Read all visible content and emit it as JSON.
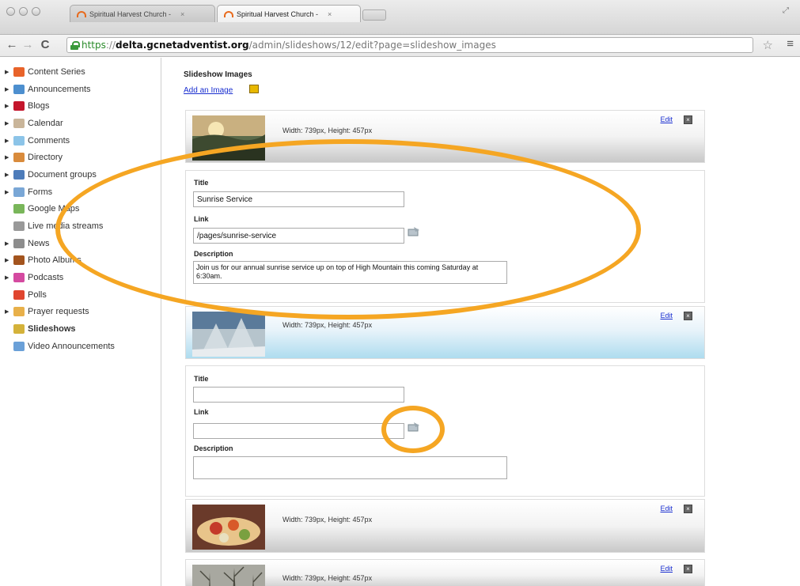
{
  "browser": {
    "tabs": [
      {
        "label": "Spiritual Harvest Church - ",
        "close": "×"
      },
      {
        "label": "Spiritual Harvest Church - ",
        "close": "×"
      }
    ],
    "url": {
      "scheme": "https",
      "separator": "://",
      "host": "delta.gcnetadventist.org",
      "path": "/admin/slideshows/12/edit?page=slideshow_images"
    },
    "icons": {
      "back": "back-arrow-icon",
      "forward": "forward-arrow-icon",
      "reload": "reload-icon",
      "lock": "lock-icon",
      "bookmark": "star-icon",
      "menu": "hamburger-menu-icon"
    }
  },
  "sidebar": {
    "items": [
      {
        "label": "Content Series",
        "expandable": true,
        "icon": "content-series-icon",
        "color": "#e8632a"
      },
      {
        "label": "Announcements",
        "expandable": true,
        "icon": "megaphone-icon",
        "color": "#4d8fcf"
      },
      {
        "label": "Blogs",
        "expandable": true,
        "icon": "book-icon",
        "color": "#c4162c"
      },
      {
        "label": "Calendar",
        "expandable": true,
        "icon": "calendar-icon",
        "color": "#c9b59a"
      },
      {
        "label": "Comments",
        "expandable": true,
        "icon": "speech-bubble-icon",
        "color": "#8cc4e8"
      },
      {
        "label": "Directory",
        "expandable": true,
        "icon": "person-icon",
        "color": "#d98b3c"
      },
      {
        "label": "Document groups",
        "expandable": true,
        "icon": "documents-icon",
        "color": "#4d7cba"
      },
      {
        "label": "Forms",
        "expandable": true,
        "icon": "form-icon",
        "color": "#7aa7d6"
      },
      {
        "label": "Google Maps",
        "expandable": false,
        "icon": "map-icon",
        "color": "#79b65a"
      },
      {
        "label": "Live media streams",
        "expandable": false,
        "icon": "antenna-icon",
        "color": "#999999"
      },
      {
        "label": "News",
        "expandable": true,
        "icon": "newspaper-icon",
        "color": "#8d8d8d"
      },
      {
        "label": "Photo Albums",
        "expandable": true,
        "icon": "photo-album-icon",
        "color": "#a3541e"
      },
      {
        "label": "Podcasts",
        "expandable": true,
        "icon": "microphone-icon",
        "color": "#d44aa0"
      },
      {
        "label": "Polls",
        "expandable": false,
        "icon": "bar-chart-icon",
        "color": "#e0452f"
      },
      {
        "label": "Prayer requests",
        "expandable": true,
        "icon": "pencil-icon",
        "color": "#e8b04a"
      },
      {
        "label": "Slideshows",
        "expandable": false,
        "icon": "slideshow-icon",
        "color": "#d4b23a",
        "active": true
      },
      {
        "label": "Video Announcements",
        "expandable": false,
        "icon": "video-icon",
        "color": "#6aa0d8"
      }
    ]
  },
  "main": {
    "section_title": "Slideshow Images",
    "add_image_label": "Add an Image",
    "edit_label": "Edit",
    "images": [
      {
        "dimensions": "Width: 739px, Height: 457px",
        "thumb": "sunrise-landscape"
      },
      {
        "dimensions": "Width: 739px, Height: 457px",
        "thumb": "snowy-trees"
      },
      {
        "dimensions": "Width: 739px, Height: 457px",
        "thumb": "food-dish"
      },
      {
        "dimensions": "Width: 739px, Height: 457px",
        "thumb": "bare-trees"
      }
    ],
    "forms": [
      {
        "title_label": "Title",
        "title_value": "Sunrise Service",
        "link_label": "Link",
        "link_value": "/pages/sunrise-service",
        "description_label": "Description",
        "description_value": "Join us for our annual sunrise service up on top of High Mountain this coming Saturday at 6:30am."
      },
      {
        "title_label": "Title",
        "title_value": "",
        "link_label": "Link",
        "link_value": "",
        "description_label": "Description",
        "description_value": ""
      }
    ]
  },
  "colors": {
    "annotation": "#f5a623",
    "link": "#1a2fd0",
    "selected_row": "#aedcef"
  }
}
